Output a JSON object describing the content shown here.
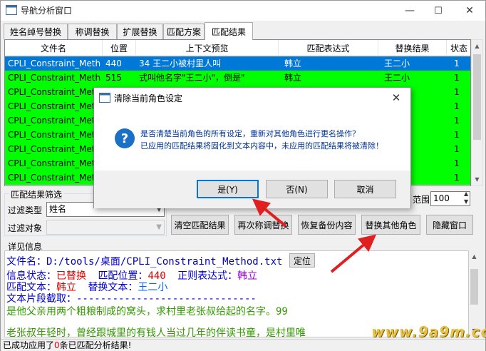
{
  "window": {
    "title": "导航分析窗口",
    "min_glyph": "—",
    "max_glyph": "☐",
    "close_glyph": "✕"
  },
  "tabs": [
    {
      "label": "姓名绰号替换"
    },
    {
      "label": "称调替换"
    },
    {
      "label": "扩展替换"
    },
    {
      "label": "匹配方案"
    },
    {
      "label": "匹配结果"
    }
  ],
  "table": {
    "columns": [
      "文件名",
      "位置",
      "上下文预览",
      "匹配表达式",
      "替换结果",
      "状态"
    ],
    "rows": [
      {
        "file": "CPLI_Constraint_Meth",
        "pos": "440",
        "ctx": "34    王二小被村里人叫",
        "expr": "韩立",
        "result": "王二小",
        "status": "1",
        "selected": true
      },
      {
        "file": "CPLI_Constraint_Meth",
        "pos": "515",
        "ctx": "式叫他名字\"王二小\"，倒是\"",
        "expr": "韩立",
        "result": "王二小",
        "status": "1"
      },
      {
        "file": "CPLI_Constraint_Meth",
        "pos": "",
        "ctx": "",
        "expr": "",
        "result": "",
        "status": "1"
      },
      {
        "file": "CPLI_Constraint_Meth",
        "pos": "",
        "ctx": "",
        "expr": "",
        "result": "",
        "status": "1"
      },
      {
        "file": "CPLI_Constraint_Meth",
        "pos": "",
        "ctx": "",
        "expr": "",
        "result": "",
        "status": "1"
      },
      {
        "file": "CPLI_Constraint_Meth",
        "pos": "",
        "ctx": "",
        "expr": "",
        "result": "",
        "status": "1"
      },
      {
        "file": "CPLI_Constraint_Meth",
        "pos": "",
        "ctx": "",
        "expr": "",
        "result": "",
        "status": "1"
      },
      {
        "file": "CPLI_Constraint_Meth",
        "pos": "",
        "ctx": "",
        "expr": "",
        "result": "",
        "status": "1"
      },
      {
        "file": "CPLI_Constraint_Meth",
        "pos": "",
        "ctx": "",
        "expr": "",
        "result": "",
        "status": "1"
      }
    ]
  },
  "filter": {
    "group_title": "匹配结果筛选",
    "type_label": "过滤类型",
    "type_value": "姓名",
    "target_label": "过滤对象",
    "target_value": "",
    "range_label": "范围",
    "range_value": "100"
  },
  "buttons": {
    "clear": "清空匹配结果",
    "rename": "再次称调替换",
    "restore": "恢复备份内容",
    "replace_other": "替换其他角色",
    "hide": "隐藏窗口"
  },
  "detail": {
    "group_title": "详见信息",
    "file_label": "文件名：",
    "file_value": "D:/tools/桌面/CPLI_Constraint_Method.txt",
    "locate_button": "定位",
    "status_label": "信息状态：",
    "status_value": "已替换",
    "pos_label": "匹配位置：",
    "pos_value": "440",
    "expr_label": "正则表达式：",
    "expr_value": "韩立",
    "match_label": "匹配文本：",
    "match_value": "韩立",
    "repl_label": "替换文本：",
    "repl_value": "王二小",
    "snippet_label": "文本片段截取：",
    "snippet_rule": "------------------------------",
    "line1": "是他父亲用两个粗粮制成的窝头，求村里老张叔给起的名字。99",
    "line2": "    老张叔年轻时，曾经跟城里的有钱人当过几年的伴读书童，是村里唯"
  },
  "status": {
    "prefix": "已成功应用了",
    "count": "0",
    "suffix": "条已匹配分析结果!"
  },
  "watermark": "www.9a9m.com",
  "dialog": {
    "title": "清除当前角色设定",
    "line1": "是否清楚当前角色的所有设定，重新对其他角色进行更名操作？",
    "line2": "已应用的匹配结果将固化到文本内容中，未应用的匹配结果将被清除！",
    "yes": "是(Y)",
    "no": "否(N)",
    "cancel": "取消"
  },
  "colors": {
    "match_row": "#00ff00",
    "selected_row": "#0078d7",
    "label_blue": "#0000cc",
    "value_red": "#e00000",
    "expr_purple": "#9900cc",
    "replace_blue": "#0066ff",
    "snippet_green": "#339900",
    "arrow_red": "#e02020"
  }
}
